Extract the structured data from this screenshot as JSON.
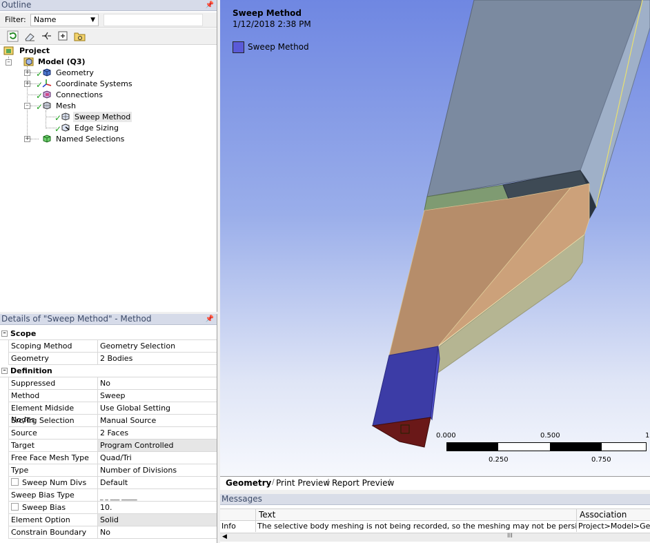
{
  "outline": {
    "title": "Outline",
    "filter_label": "Filter:",
    "filter_value": "Name",
    "tree": {
      "project": "Project",
      "model": "Model (Q3)",
      "geometry": "Geometry",
      "coordinate_systems": "Coordinate Systems",
      "connections": "Connections",
      "mesh": "Mesh",
      "sweep_method": "Sweep Method",
      "edge_sizing": "Edge Sizing",
      "named_selections": "Named Selections"
    }
  },
  "details": {
    "title": "Details of \"Sweep Method\" - Method",
    "sections": {
      "scope": "Scope",
      "definition": "Definition"
    },
    "rows": [
      {
        "key": "Scoping Method",
        "value": "Geometry Selection"
      },
      {
        "key": "Geometry",
        "value": "2 Bodies"
      },
      {
        "key": "Suppressed",
        "value": "No"
      },
      {
        "key": "Method",
        "value": "Sweep"
      },
      {
        "key": "Element Midside Nodes",
        "value": "Use Global Setting"
      },
      {
        "key": "Src/Trg Selection",
        "value": "Manual Source"
      },
      {
        "key": "Source",
        "value": "2 Faces"
      },
      {
        "key": "Target",
        "value": "Program Controlled"
      },
      {
        "key": "Free Face Mesh Type",
        "value": "Quad/Tri"
      },
      {
        "key": "Type",
        "value": "Number of Divisions"
      },
      {
        "key": "Sweep Num Divs",
        "value": "Default"
      },
      {
        "key": "Sweep Bias Type",
        "value": "_ _ ___ _____"
      },
      {
        "key": "Sweep Bias",
        "value": "10."
      },
      {
        "key": "Element Option",
        "value": "Solid"
      },
      {
        "key": "Constrain Boundary",
        "value": "No"
      }
    ]
  },
  "viewport": {
    "title": "Sweep Method",
    "date": "1/12/2018 2:38 PM",
    "legend_label": "Sweep Method",
    "legend_color": "#5a5ad8",
    "scale": {
      "tick_0": "0.000",
      "tick_1": "0.250",
      "tick_2": "0.500",
      "tick_3": "0.750",
      "tick_4": "1"
    }
  },
  "tabs": [
    "Geometry",
    "Print Preview",
    "Report Preview"
  ],
  "messages": {
    "title": "Messages",
    "columns": [
      "",
      "Text",
      "Association"
    ],
    "rows": [
      {
        "type": "Info",
        "text": "The selective body meshing is not being recorded, so the meshing may not be persistent",
        "association": "Project>Model>Geometry"
      }
    ],
    "scroll_glyph": "III"
  },
  "colors": {
    "accent_check": "#1a9e1a",
    "pane_header": "#d6dbe9"
  }
}
